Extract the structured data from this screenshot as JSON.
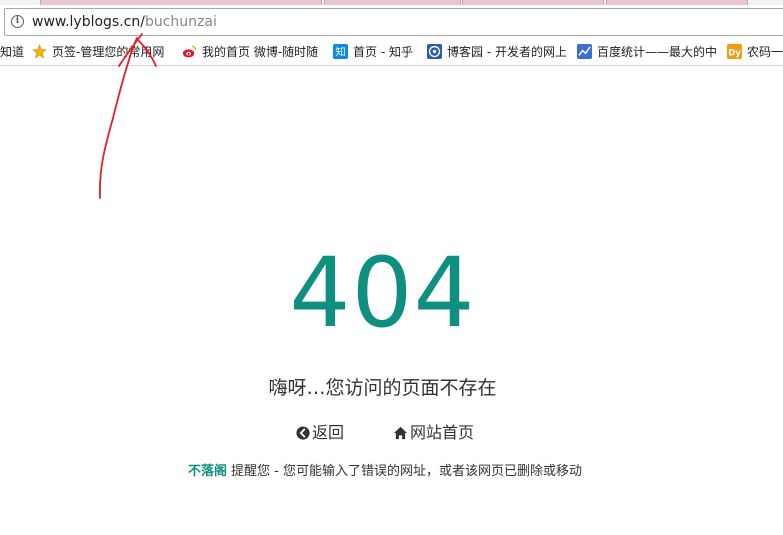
{
  "browser": {
    "url_host": "www.lyblogs.cn/",
    "url_path": "buchunzai"
  },
  "bookmarks": [
    {
      "label": "知道",
      "icon": "none"
    },
    {
      "label": "页签-管理您的常用网",
      "icon": "star-icon"
    },
    {
      "label": "我的首页 微博-随时随",
      "icon": "weibo-icon"
    },
    {
      "label": "首页 - 知乎",
      "icon": "zhihu-icon"
    },
    {
      "label": "博客园 - 开发者的网上",
      "icon": "cnblogs-icon"
    },
    {
      "label": "百度统计——最大的中",
      "icon": "baidu-tongji-icon"
    },
    {
      "label": "农码一",
      "icon": "dy-icon"
    }
  ],
  "error": {
    "code": "404",
    "message": "嗨呀…您访问的页面不存在",
    "back_label": "返回",
    "home_label": "网站首页",
    "brand": "不落阁",
    "note": "提醒您 - 您可能输入了错误的网址，或者该网页已删除或移动"
  },
  "colors": {
    "accent": "#0f8f7f",
    "annotation": "#e0202a"
  }
}
